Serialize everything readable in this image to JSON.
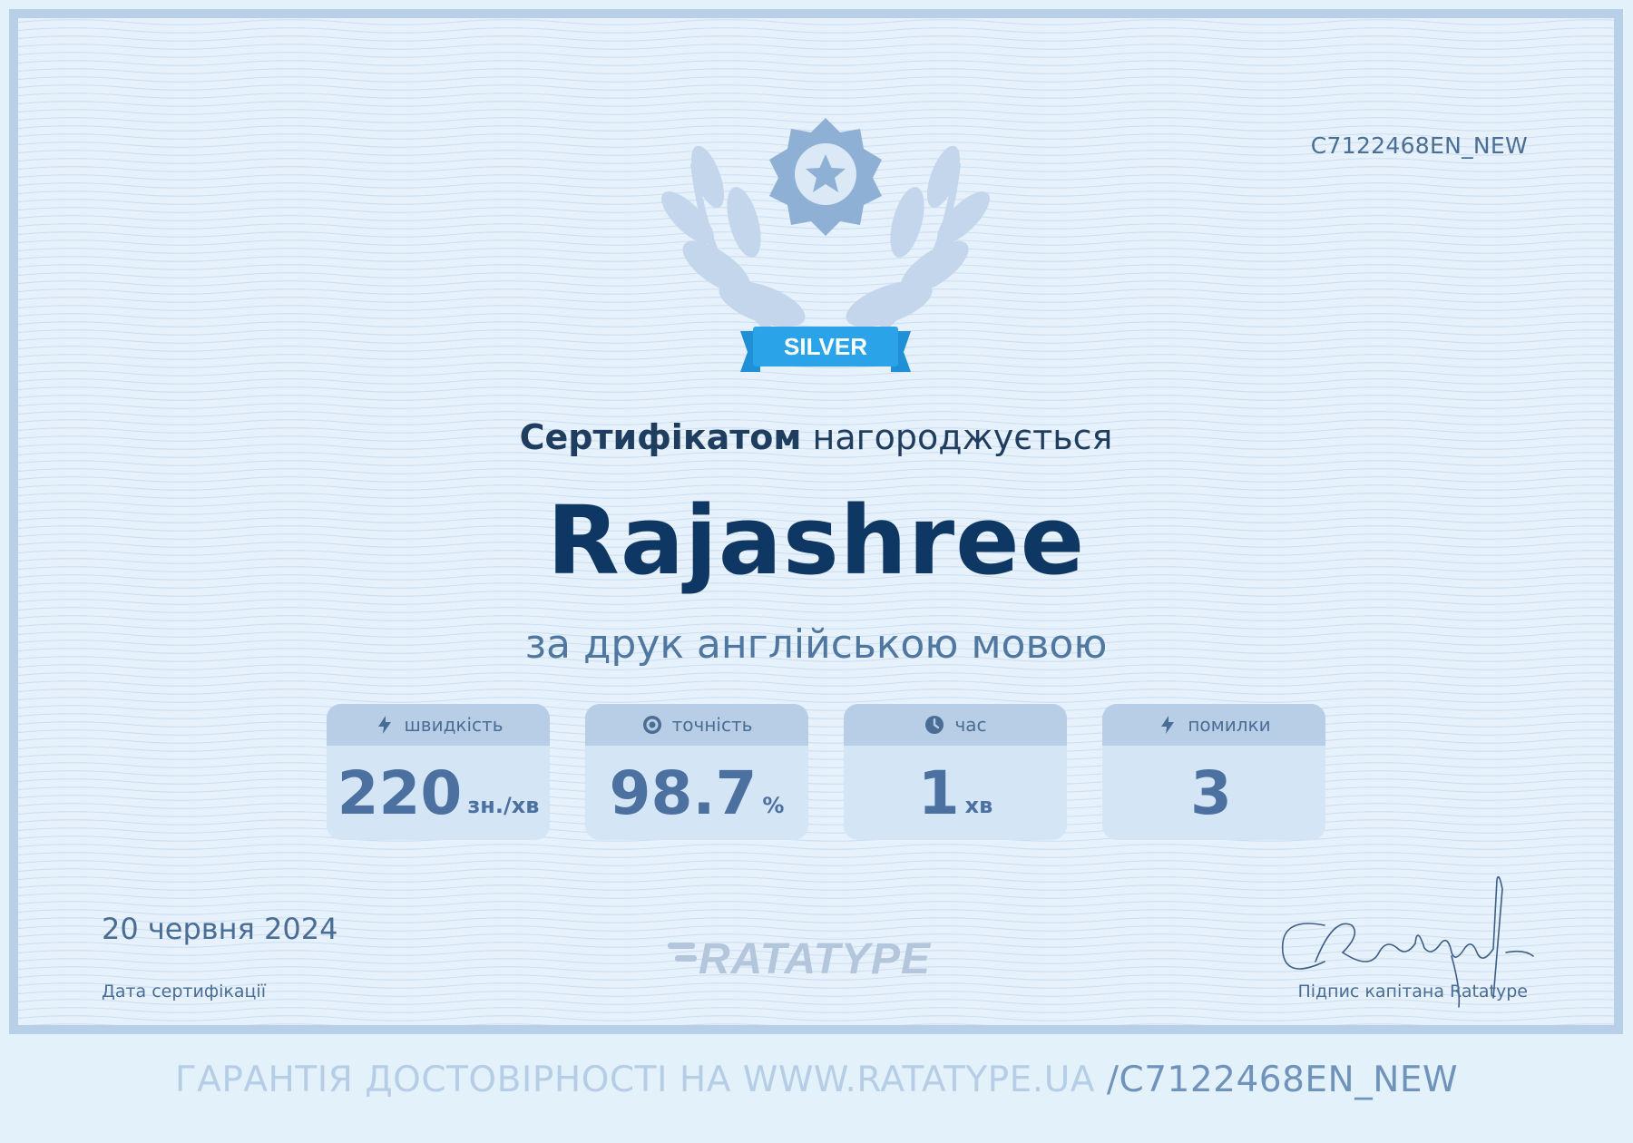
{
  "certificate": {
    "id": "C7122468EN_NEW",
    "badge_level": "SILVER",
    "title_strong": "Сертифікатом",
    "title_rest": " нагороджується",
    "recipient_name": "Rajashree",
    "subtitle": "за друк англійською мовою",
    "stats": [
      {
        "label": "швидкість",
        "value": "220",
        "unit": "зн./хв",
        "icon": "lightning-icon"
      },
      {
        "label": "точність",
        "value": "98.7",
        "unit": "%",
        "icon": "target-icon"
      },
      {
        "label": "час",
        "value": "1",
        "unit": "хв",
        "icon": "clock-icon"
      },
      {
        "label": "помилки",
        "value": "3",
        "unit": "",
        "icon": "lightning-icon"
      }
    ],
    "date": "20 червня 2024",
    "date_label": "Дата сертифікації",
    "brand": "RATATYPE",
    "signature_label": "Підпис капітана Ratatype"
  },
  "footer": {
    "text": "ГАРАНТІЯ ДОСТОВІРНОСТІ НА WWW.RATATYPE.UA ",
    "code": "/C7122468EN_NEW"
  },
  "colors": {
    "page_bg": "#e3f1fb",
    "frame": "#b8cfe8",
    "name": "#0f3764",
    "accent_ribbon": "#2aa3e8",
    "stat_bg": "#d4e5f6",
    "stat_head": "#b8cde6"
  }
}
